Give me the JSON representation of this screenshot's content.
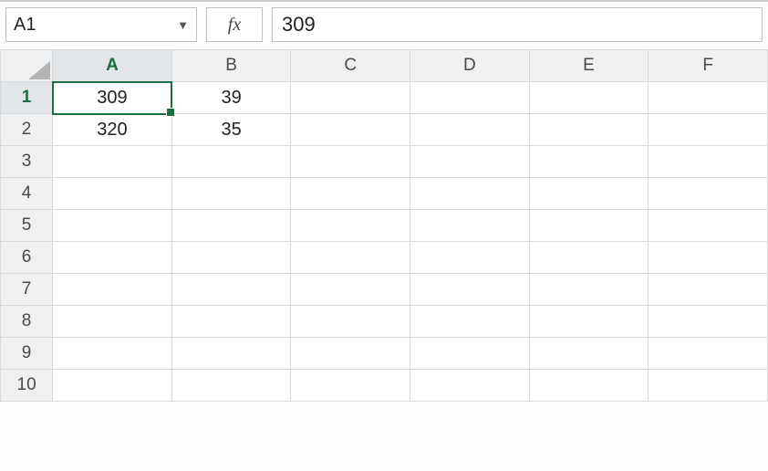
{
  "name_box": {
    "value": "A1"
  },
  "fx_label": "fx",
  "formula_bar": {
    "value": "309"
  },
  "columns": [
    "A",
    "B",
    "C",
    "D",
    "E",
    "F"
  ],
  "rows": [
    "1",
    "2",
    "3",
    "4",
    "5",
    "6",
    "7",
    "8",
    "9",
    "10"
  ],
  "active_col_index": 0,
  "active_row_index": 0,
  "cells": {
    "A1": "309",
    "B1": "39",
    "A2": "320",
    "B2": "35"
  },
  "chart_data": {
    "type": "table",
    "columns": [
      "A",
      "B"
    ],
    "rows": [
      [
        309,
        39
      ],
      [
        320,
        35
      ]
    ]
  }
}
